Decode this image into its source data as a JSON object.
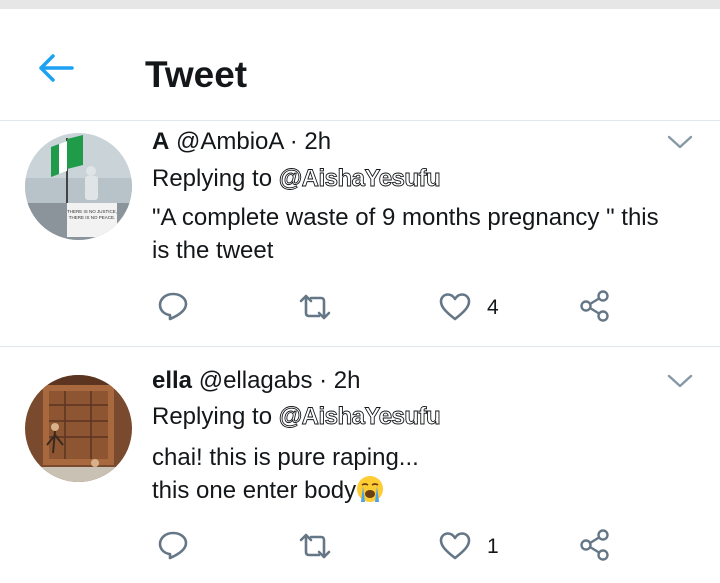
{
  "header": {
    "title": "Tweet",
    "back_icon": "arrow-left-icon",
    "accent": "#1da1f2"
  },
  "tweets": [
    {
      "name": "A",
      "handle": "@AmbioA",
      "sep": " · ",
      "time": "2h",
      "replying_prefix": "Replying to ",
      "replying_to": "@AishaYesufu",
      "text_lines": [
        "\"A complete waste of 9 months pregnancy \" this",
        "is the tweet"
      ],
      "likes": "4",
      "avatar_sign_text": [
        "THERE IS NO JUSTICE,",
        "THERE IS NO PEACE."
      ]
    },
    {
      "name": "ella",
      "handle": "@ellagabs",
      "sep": " · ",
      "time": "2h",
      "replying_prefix": "Replying to ",
      "replying_to": "@AishaYesufu",
      "text_lines": [
        "chai! this is pure raping...",
        "this one enter body"
      ],
      "emoji": "loudly-crying-face",
      "likes": "1"
    }
  ]
}
